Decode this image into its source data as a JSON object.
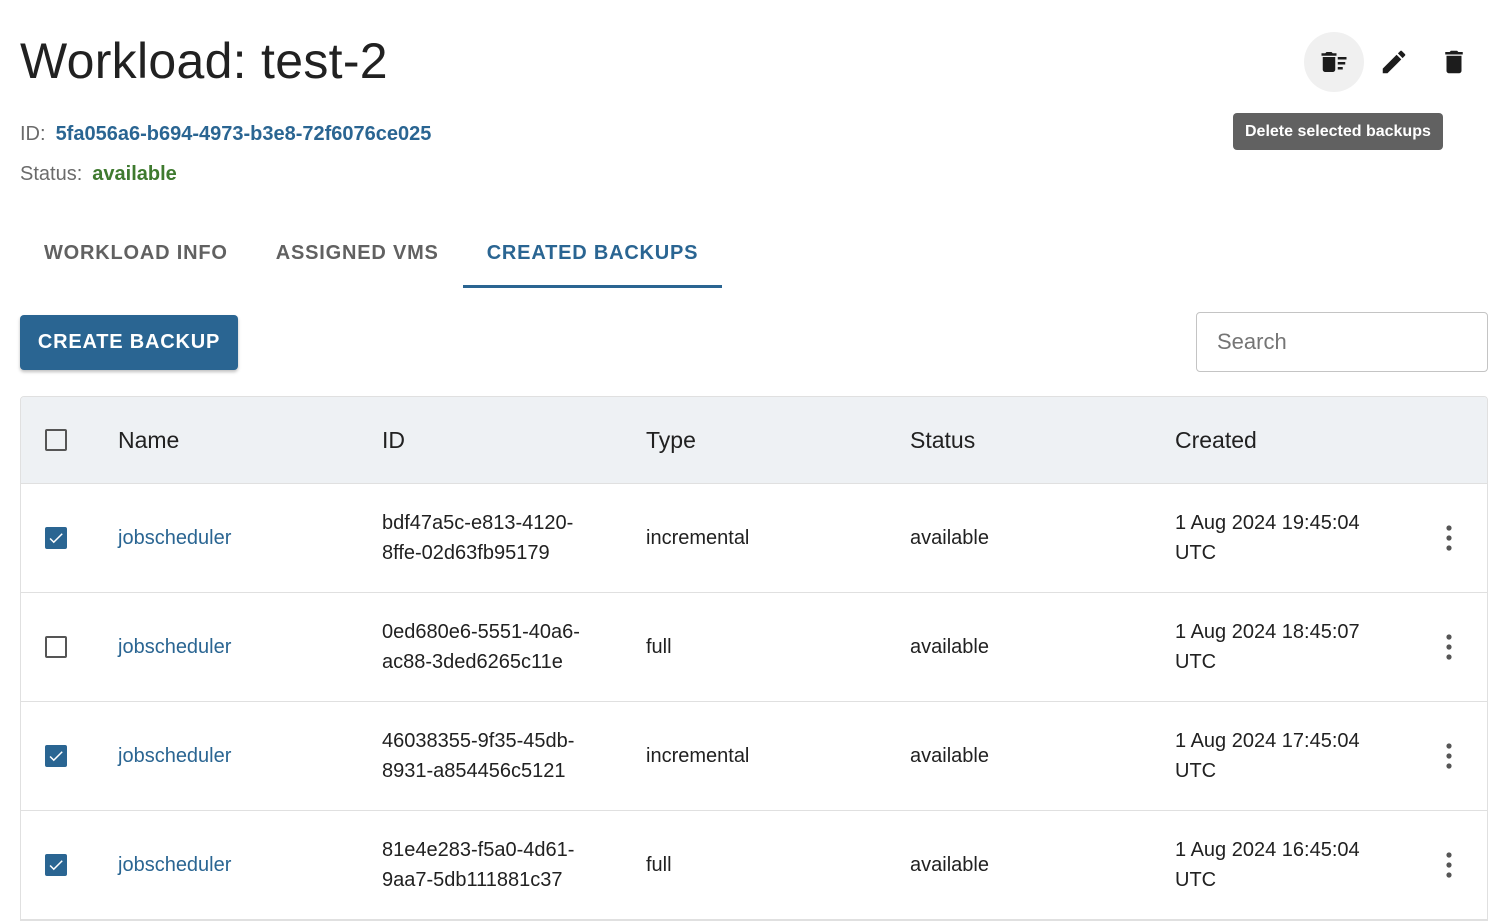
{
  "header": {
    "title": "Workload: test-2",
    "id_label": "ID:",
    "id_value": "5fa056a6-b694-4973-b3e8-72f6076ce025",
    "status_label": "Status:",
    "status_value": "available",
    "actions": [
      {
        "icon": "delete-sweep-icon"
      },
      {
        "icon": "pencil-icon"
      },
      {
        "icon": "trash-icon"
      }
    ],
    "tooltip": "Delete selected backups"
  },
  "tabs": [
    {
      "label": "WORKLOAD INFO",
      "active": false
    },
    {
      "label": "ASSIGNED VMS",
      "active": false
    },
    {
      "label": "CREATED BACKUPS",
      "active": true
    }
  ],
  "toolbar": {
    "create_label": "CREATE BACKUP",
    "search_placeholder": "Search"
  },
  "table": {
    "columns": [
      "Name",
      "ID",
      "Type",
      "Status",
      "Created"
    ],
    "header_checked": false,
    "rows": [
      {
        "checked": true,
        "name": "jobscheduler",
        "id_line1": "bdf47a5c-e813-4120-",
        "id_line2": "8ffe-02d63fb95179",
        "type": "incremental",
        "status": "available",
        "created_line1": "1 Aug 2024 19:45:04",
        "created_line2": "UTC"
      },
      {
        "checked": false,
        "name": "jobscheduler",
        "id_line1": "0ed680e6-5551-40a6-",
        "id_line2": "ac88-3ded6265c11e",
        "type": "full",
        "status": "available",
        "created_line1": "1 Aug 2024 18:45:07",
        "created_line2": "UTC"
      },
      {
        "checked": true,
        "name": "jobscheduler",
        "id_line1": "46038355-9f35-45db-",
        "id_line2": "8931-a854456c5121",
        "type": "incremental",
        "status": "available",
        "created_line1": "1 Aug 2024 17:45:04",
        "created_line2": "UTC"
      },
      {
        "checked": true,
        "name": "jobscheduler",
        "id_line1": "81e4e283-f5a0-4d61-",
        "id_line2": "9aa7-5db111881c37",
        "type": "full",
        "status": "available",
        "created_line1": "1 Aug 2024 16:45:04",
        "created_line2": "UTC"
      }
    ]
  },
  "colors": {
    "accent": "#2a6592",
    "status_ok": "#3f7a2f",
    "header_bg": "#eef1f4",
    "tooltip_bg": "#616161"
  }
}
